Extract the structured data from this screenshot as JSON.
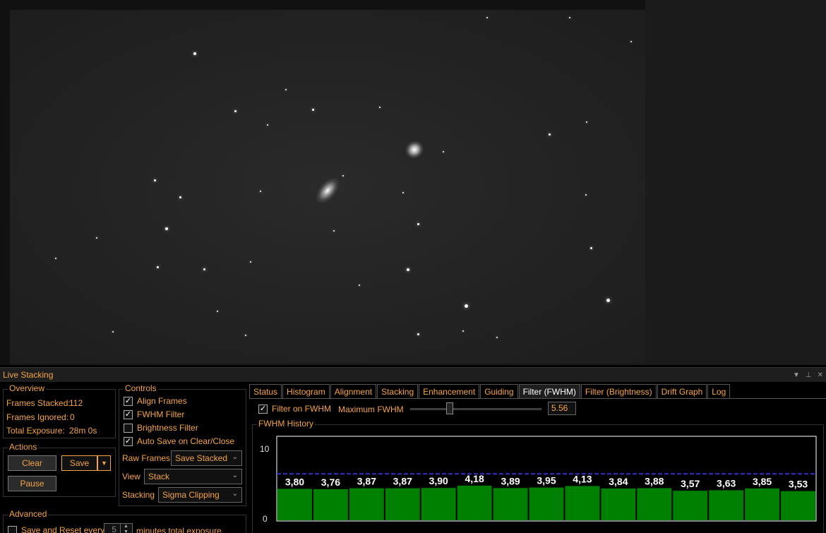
{
  "panel": {
    "title": "Live Stacking"
  },
  "overview": {
    "title": "Overview",
    "frames_stacked_label": "Frames Stacked:",
    "frames_stacked_value": "112",
    "frames_ignored_label": "Frames Ignored:",
    "frames_ignored_value": "0",
    "total_exposure_label": "Total Exposure:",
    "total_exposure_value": "28m 0s"
  },
  "actions": {
    "title": "Actions",
    "clear_label": "Clear",
    "save_label": "Save",
    "pause_label": "Pause"
  },
  "controls": {
    "title": "Controls",
    "align_frames": {
      "label": "Align Frames",
      "checked": true
    },
    "fwhm_filter": {
      "label": "FWHM Filter",
      "checked": true
    },
    "brightness_filter": {
      "label": "Brightness Filter",
      "checked": false
    },
    "auto_save": {
      "label": "Auto Save on Clear/Close",
      "checked": true
    },
    "raw_frames_label": "Raw Frames",
    "raw_frames_value": "Save Stacked",
    "view_label": "View",
    "view_value": "Stack",
    "stacking_label": "Stacking",
    "stacking_value": "Sigma Clipping"
  },
  "advanced": {
    "title": "Advanced",
    "save_reset_label": "Save and Reset every",
    "save_reset_value": "5",
    "minutes_label": "minutes total exposure"
  },
  "tabs": [
    {
      "label": "Status"
    },
    {
      "label": "Histogram"
    },
    {
      "label": "Alignment"
    },
    {
      "label": "Stacking"
    },
    {
      "label": "Enhancement"
    },
    {
      "label": "Guiding"
    },
    {
      "label": "Filter (FWHM)",
      "active": true
    },
    {
      "label": "Filter (Brightness)"
    },
    {
      "label": "Drift Graph"
    },
    {
      "label": "Log"
    }
  ],
  "fwhm_filter_tab": {
    "filter_on_label": "Filter on FWHM",
    "filter_on_checked": true,
    "max_label": "Maximum FWHM",
    "max_value": "5.56",
    "max_fraction": 0.3
  },
  "colors": {
    "accent": "#f5a442",
    "bar": "#008000",
    "threshold": "#3333cc"
  },
  "chart_data": {
    "type": "bar",
    "title": "FWHM History",
    "ylim": [
      0,
      10
    ],
    "y_ticks": [
      "10",
      "0"
    ],
    "threshold": 5.56,
    "values": [
      3.8,
      3.76,
      3.87,
      3.87,
      3.9,
      4.18,
      3.89,
      3.95,
      4.13,
      3.84,
      3.88,
      3.57,
      3.63,
      3.85,
      3.53
    ],
    "value_labels": [
      "3,80",
      "3,76",
      "3,87",
      "3,87",
      "3,90",
      "4,18",
      "3,89",
      "3,95",
      "4,13",
      "3,84",
      "3,88",
      "3,57",
      "3,63",
      "3,85",
      "3,53"
    ]
  }
}
